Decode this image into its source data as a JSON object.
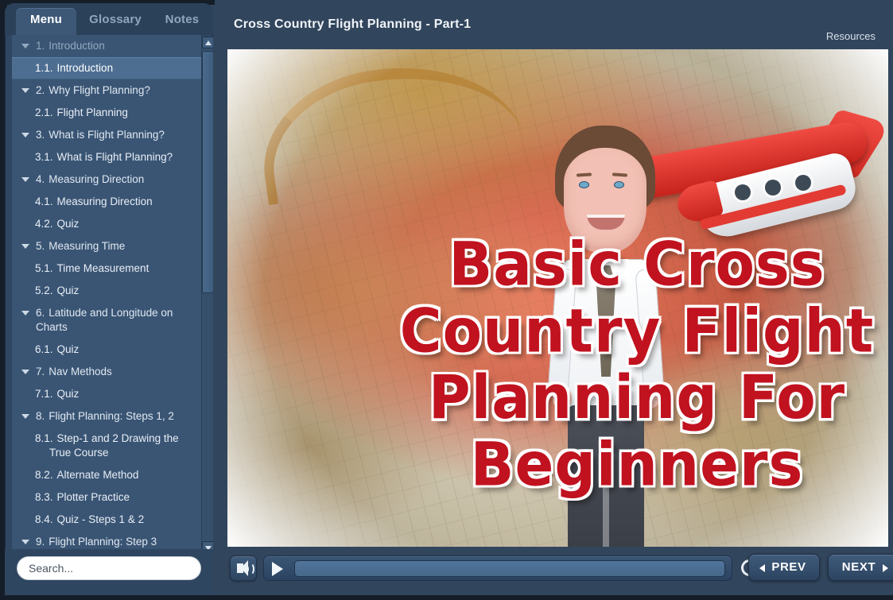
{
  "header": {
    "slide_title": "Cross Country Flight Planning - Part-1",
    "resources_label": "Resources"
  },
  "sidebar": {
    "tabs": [
      {
        "label": "Menu",
        "active": true
      },
      {
        "label": "Glossary",
        "active": false
      },
      {
        "label": "Notes",
        "active": false
      }
    ],
    "search": {
      "placeholder": "Search...",
      "value": ""
    },
    "menu": [
      {
        "type": "topic",
        "num": "1.",
        "label": "Introduction",
        "visited": true
      },
      {
        "type": "sub",
        "num": "1.1.",
        "label": "Introduction",
        "current": true
      },
      {
        "type": "topic",
        "num": "2.",
        "label": "Why Flight Planning?",
        "visited": false
      },
      {
        "type": "sub",
        "num": "2.1.",
        "label": "Flight Planning",
        "current": false
      },
      {
        "type": "topic",
        "num": "3.",
        "label": "What is Flight Planning?",
        "visited": false
      },
      {
        "type": "sub",
        "num": "3.1.",
        "label": "What is Flight Planning?",
        "current": false
      },
      {
        "type": "topic",
        "num": "4.",
        "label": "Measuring Direction",
        "visited": false
      },
      {
        "type": "sub",
        "num": "4.1.",
        "label": "Measuring Direction",
        "current": false
      },
      {
        "type": "sub",
        "num": "4.2.",
        "label": "Quiz",
        "current": false
      },
      {
        "type": "topic",
        "num": "5.",
        "label": "Measuring Time",
        "visited": false
      },
      {
        "type": "sub",
        "num": "5.1.",
        "label": "Time Measurement",
        "current": false
      },
      {
        "type": "sub",
        "num": "5.2.",
        "label": "Quiz",
        "current": false
      },
      {
        "type": "topic",
        "num": "6.",
        "label": "Latitude and Longitude on Charts",
        "visited": false
      },
      {
        "type": "sub",
        "num": "6.1.",
        "label": "Quiz",
        "current": false
      },
      {
        "type": "topic",
        "num": "7.",
        "label": "Nav Methods",
        "visited": false
      },
      {
        "type": "sub",
        "num": "7.1.",
        "label": "Quiz",
        "current": false
      },
      {
        "type": "topic",
        "num": "8.",
        "label": "Flight Planning: Steps 1, 2",
        "visited": false
      },
      {
        "type": "sub",
        "num": "8.1.",
        "label": "Step-1 and 2 Drawing the True Course",
        "current": false
      },
      {
        "type": "sub",
        "num": "8.2.",
        "label": "Alternate Method",
        "current": false
      },
      {
        "type": "sub",
        "num": "8.3.",
        "label": "Plotter Practice",
        "current": false
      },
      {
        "type": "sub",
        "num": "8.4.",
        "label": "Quiz - Steps 1 & 2",
        "current": false
      },
      {
        "type": "topic",
        "num": "9.",
        "label": "Flight Planning: Step 3",
        "visited": false
      }
    ]
  },
  "slide": {
    "art_title_lines": [
      "Basic Cross",
      "Country Flight",
      "Planning For",
      "Beginners"
    ],
    "art_title_color": "#c1121f"
  },
  "controls": {
    "volume_icon": "speaker-icon",
    "play_icon": "play-icon",
    "replay_icon": "replay-icon",
    "progress_percent": 0,
    "prev_label": "PREV",
    "next_label": "NEXT"
  },
  "colors": {
    "frame": "#151d28",
    "panel": "#2f4660",
    "menu_bg": "#3a5574",
    "selected": "#4d6e91",
    "accent_text": "#ffffff"
  }
}
